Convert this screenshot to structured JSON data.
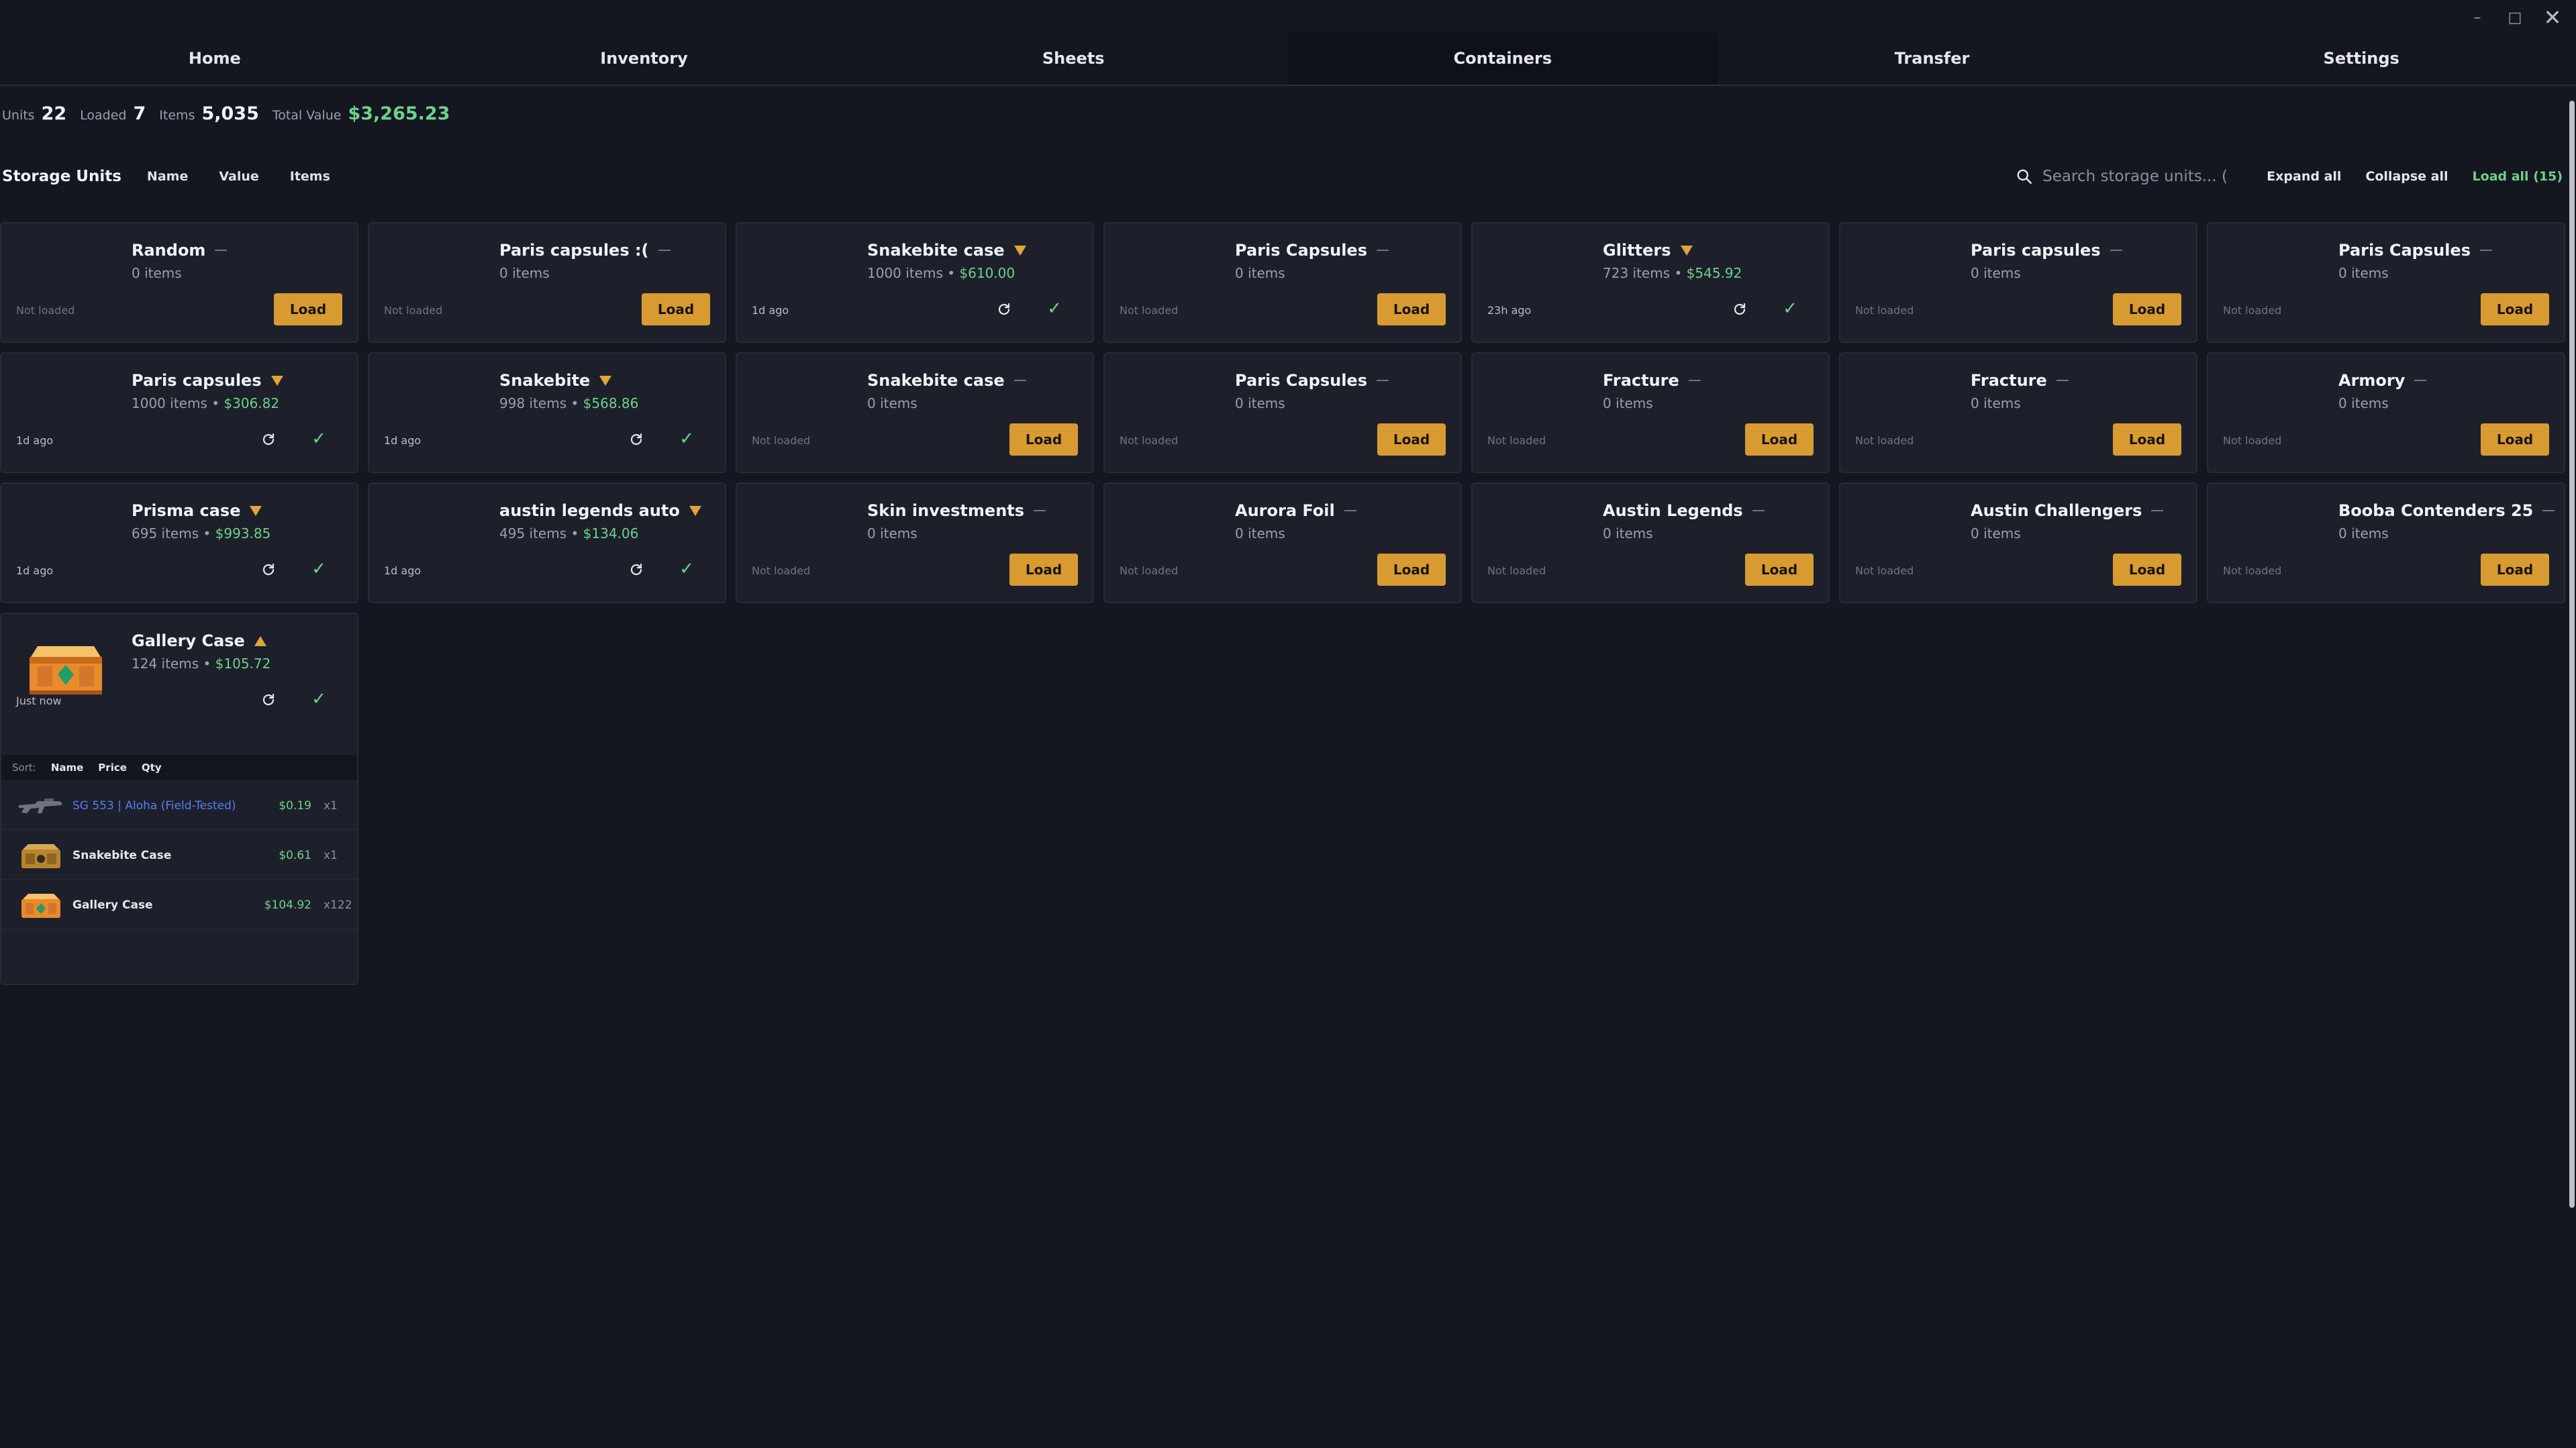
{
  "window": {
    "controls": [
      "minimize",
      "maximize",
      "close"
    ]
  },
  "nav": {
    "tabs": [
      {
        "label": "Home",
        "active": false
      },
      {
        "label": "Inventory",
        "active": false
      },
      {
        "label": "Sheets",
        "active": false
      },
      {
        "label": "Containers",
        "active": true
      },
      {
        "label": "Transfer",
        "active": false
      },
      {
        "label": "Settings",
        "active": false
      }
    ]
  },
  "stats": {
    "units_label": "Units",
    "units_value": "22",
    "loaded_label": "Loaded",
    "loaded_value": "7",
    "items_label": "Items",
    "items_value": "5,035",
    "total_label": "Total Value",
    "total_value": "$3,265.23"
  },
  "toolbar": {
    "title": "Storage Units",
    "sort_name": "Name",
    "sort_value": "Value",
    "sort_items": "Items",
    "search_placeholder": "Search storage units... (",
    "expand_all": "Expand all",
    "collapse_all": "Collapse all",
    "load_all": "Load all (15)"
  },
  "load_label": "Load",
  "colors": {
    "accent": "#d89b32",
    "money": "#6dd28a",
    "link": "#5b7cf0",
    "background": "#151720",
    "card": "#1d202b"
  },
  "units": [
    {
      "name": "Random",
      "loaded": false,
      "items": "0 items",
      "value": "",
      "status": "Not loaded"
    },
    {
      "name": "Paris capsules :(",
      "loaded": false,
      "items": "0 items",
      "value": "",
      "status": "Not loaded"
    },
    {
      "name": "Snakebite case",
      "loaded": true,
      "items": "1000 items",
      "value": "$610.00",
      "status": "1d ago"
    },
    {
      "name": "Paris Capsules",
      "loaded": false,
      "items": "0 items",
      "value": "",
      "status": "Not loaded"
    },
    {
      "name": "Glitters",
      "loaded": true,
      "items": "723 items",
      "value": "$545.92",
      "status": "23h ago"
    },
    {
      "name": "Paris capsules",
      "loaded": false,
      "items": "0 items",
      "value": "",
      "status": "Not loaded"
    },
    {
      "name": "Paris Capsules",
      "loaded": false,
      "items": "0 items",
      "value": "",
      "status": "Not loaded"
    },
    {
      "name": "Paris capsules",
      "loaded": true,
      "items": "1000 items",
      "value": "$306.82",
      "status": "1d ago"
    },
    {
      "name": "Snakebite",
      "loaded": true,
      "items": "998 items",
      "value": "$568.86",
      "status": "1d ago"
    },
    {
      "name": "Snakebite case",
      "loaded": false,
      "items": "0 items",
      "value": "",
      "status": "Not loaded"
    },
    {
      "name": "Paris Capsules",
      "loaded": false,
      "items": "0 items",
      "value": "",
      "status": "Not loaded"
    },
    {
      "name": "Fracture",
      "loaded": false,
      "items": "0 items",
      "value": "",
      "status": "Not loaded"
    },
    {
      "name": "Fracture",
      "loaded": false,
      "items": "0 items",
      "value": "",
      "status": "Not loaded"
    },
    {
      "name": "Armory",
      "loaded": false,
      "items": "0 items",
      "value": "",
      "status": "Not loaded"
    },
    {
      "name": "Prisma case",
      "loaded": true,
      "items": "695 items",
      "value": "$993.85",
      "status": "1d ago"
    },
    {
      "name": "austin legends auto",
      "loaded": true,
      "items": "495 items",
      "value": "$134.06",
      "status": "1d ago"
    },
    {
      "name": "Skin investments",
      "loaded": false,
      "items": "0 items",
      "value": "",
      "status": "Not loaded"
    },
    {
      "name": "Aurora Foil",
      "loaded": false,
      "items": "0 items",
      "value": "",
      "status": "Not loaded"
    },
    {
      "name": "Austin Legends",
      "loaded": false,
      "items": "0 items",
      "value": "",
      "status": "Not loaded"
    },
    {
      "name": "Austin Challengers",
      "loaded": false,
      "items": "0 items",
      "value": "",
      "status": "Not loaded"
    },
    {
      "name": "Booba Contenders 25",
      "loaded": false,
      "items": "0 items",
      "value": "",
      "status": "Not loaded"
    }
  ],
  "expanded": {
    "name": "Gallery Case",
    "items": "124 items",
    "value": "$105.72",
    "status": "Just now",
    "sort_label": "Sort:",
    "sort_options": [
      "Name",
      "Price",
      "Qty"
    ],
    "contents": [
      {
        "name": "SG 553 | Aloha (Field-Tested)",
        "price": "$0.19",
        "qty": "x1",
        "thumb": "rifle-icon",
        "is_skin": true
      },
      {
        "name": "Snakebite Case",
        "price": "$0.61",
        "qty": "x1",
        "thumb": "case-icon",
        "is_skin": false
      },
      {
        "name": "Gallery Case",
        "price": "$104.92",
        "qty": "x122",
        "thumb": "case-icon",
        "is_skin": false
      }
    ]
  }
}
